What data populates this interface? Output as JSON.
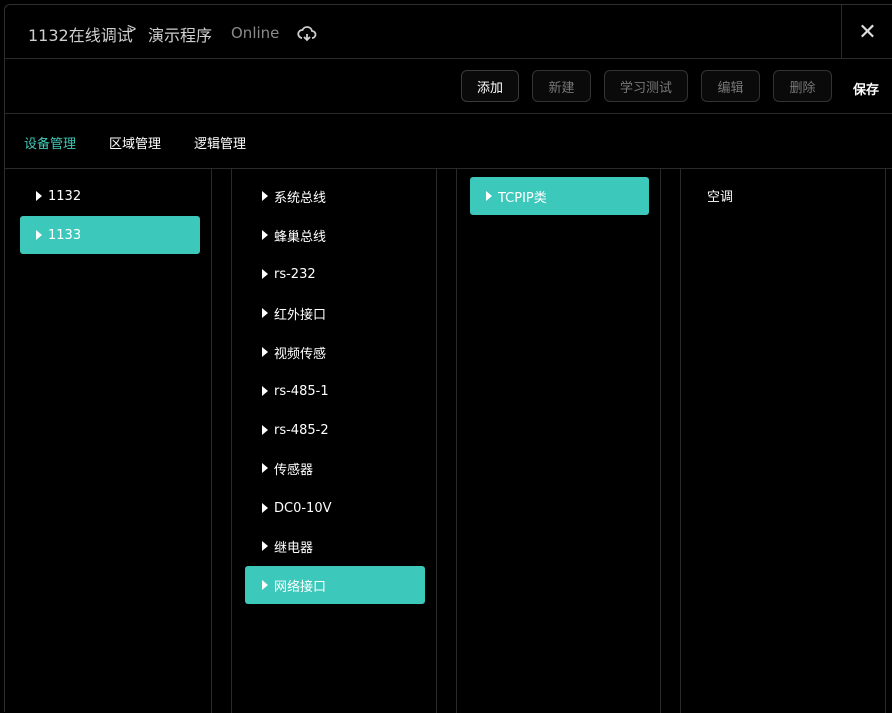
{
  "header": {
    "breadcrumb_root": "1132在线调试",
    "breadcrumb_sep": ">",
    "breadcrumb_current": "演示程序",
    "status": "Online",
    "close_glyph": "✕"
  },
  "toolbar": {
    "add": "添加",
    "new": "新建",
    "learn_test": "学习测试",
    "edit": "编辑",
    "delete": "删除",
    "save": "保存"
  },
  "tabs": [
    {
      "label": "设备管理",
      "active": true
    },
    {
      "label": "区域管理",
      "active": false
    },
    {
      "label": "逻辑管理",
      "active": false
    }
  ],
  "columns": {
    "col1": [
      "1132",
      "1133"
    ],
    "col2": [
      "系统总线",
      "蜂巢总线",
      "rs-232",
      "红外接口",
      "视频传感",
      "rs-485-1",
      "rs-485-2",
      "传感器",
      "DC0-10V",
      "继电器",
      "网络接口"
    ],
    "col3": [
      "TCPIP类"
    ],
    "col4": [
      "空调"
    ]
  },
  "colors": {
    "accent": "#3cc9bb",
    "tab_active": "#3ec9b8",
    "background": "#000000"
  },
  "icons": {
    "status_icon": "cloud-sync-icon",
    "close": "close-icon",
    "expand": "caret-right-icon"
  }
}
